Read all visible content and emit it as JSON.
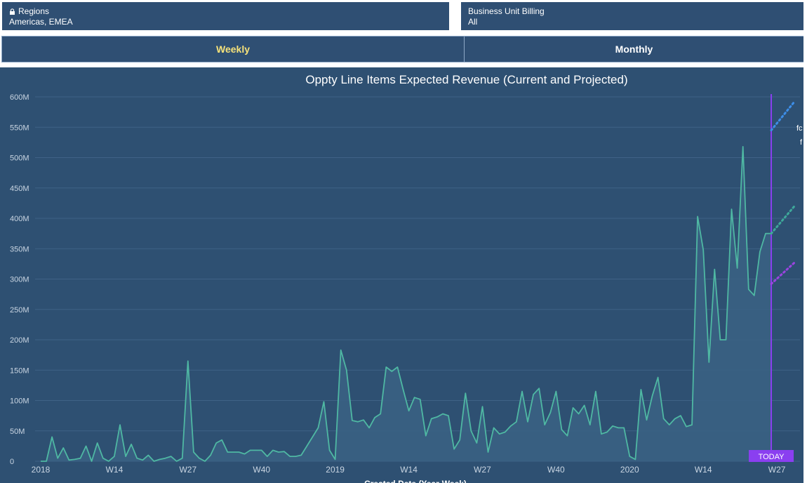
{
  "filters": {
    "regions": {
      "label": "Regions",
      "value": "Americas, EMEA"
    },
    "business_unit": {
      "label": "Business Unit Billing",
      "value": "All"
    }
  },
  "toggle": {
    "weekly": "Weekly",
    "monthly": "Monthly",
    "selected": "Weekly"
  },
  "colors": {
    "background": "#2e5072",
    "line": "#4fb8a3",
    "today": "#8a3ff0",
    "projection_high": "#3d8ee8",
    "projection_mid": "#3ea89a",
    "projection_low": "#9b44e0"
  },
  "chart_data": {
    "type": "area",
    "title": "Oppty Line Items Expected Revenue (Current and Projected)",
    "xlabel": "Created Date (Year-Week)",
    "ylabel": "",
    "ylim": [
      0,
      600
    ],
    "y_ticks": [
      0,
      50,
      100,
      150,
      200,
      250,
      300,
      350,
      400,
      450,
      500,
      550,
      600
    ],
    "y_tick_labels": [
      "0",
      "50M",
      "100M",
      "150M",
      "200M",
      "250M",
      "300M",
      "350M",
      "400M",
      "450M",
      "500M",
      "550M",
      "600M"
    ],
    "x_ticks": [
      {
        "label": "2018",
        "week_index": 0
      },
      {
        "label": "W14",
        "week_index": 13
      },
      {
        "label": "W27",
        "week_index": 26
      },
      {
        "label": "W40",
        "week_index": 39
      },
      {
        "label": "2019",
        "week_index": 52
      },
      {
        "label": "W14",
        "week_index": 65
      },
      {
        "label": "W27",
        "week_index": 78
      },
      {
        "label": "W40",
        "week_index": 91
      },
      {
        "label": "2020",
        "week_index": 104
      },
      {
        "label": "W14",
        "week_index": 117
      },
      {
        "label": "W27",
        "week_index": 130
      }
    ],
    "grid": true,
    "series": [
      {
        "values": [
          0,
          0,
          40,
          5,
          22,
          2,
          3,
          5,
          25,
          0,
          30,
          5,
          0,
          8,
          60,
          8,
          28,
          5,
          2,
          10,
          0,
          3,
          5,
          8,
          0,
          5,
          165,
          15,
          5,
          0,
          10,
          30,
          35,
          15,
          15,
          15,
          12,
          18,
          18,
          18,
          8,
          18,
          15,
          16,
          8,
          8,
          10,
          25,
          40,
          55,
          98,
          18,
          3,
          183,
          150,
          67,
          65,
          68,
          55,
          72,
          78,
          155,
          148,
          155,
          118,
          83,
          105,
          102,
          42,
          70,
          73,
          78,
          75,
          20,
          35,
          112,
          50,
          30,
          90,
          15,
          55,
          45,
          48,
          58,
          65,
          115,
          65,
          110,
          120,
          60,
          80,
          115,
          52,
          42,
          88,
          78,
          92,
          60,
          115,
          45,
          48,
          58,
          55,
          55,
          8,
          3,
          118,
          68,
          108,
          138,
          70,
          60,
          70,
          75,
          57,
          60,
          403,
          348,
          163,
          316,
          200,
          200,
          415,
          318,
          518,
          283,
          273,
          345,
          375,
          375
        ]
      }
    ],
    "today_marker": {
      "label": "TODAY",
      "week_index": 129
    },
    "projections": [
      {
        "start": 545,
        "end": 592
      },
      {
        "start": 375,
        "end": 420
      },
      {
        "start": 292,
        "end": 327
      }
    ],
    "cut_off_text": [
      "fc",
      "f"
    ]
  }
}
